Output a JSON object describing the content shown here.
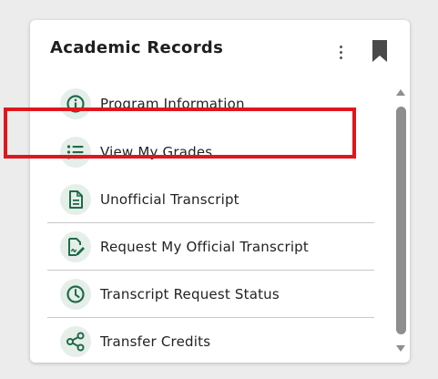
{
  "card": {
    "title": "Academic Records",
    "menu_icon": "more-vertical-icon",
    "bookmark_icon": "bookmark-icon"
  },
  "items": [
    {
      "label": "Program Information",
      "icon": "info-icon"
    },
    {
      "label": "View My Grades",
      "icon": "list-icon",
      "highlighted": true
    },
    {
      "label": "Unofficial Transcript",
      "icon": "document-icon"
    },
    {
      "label": "Request My Official Transcript",
      "icon": "signed-document-icon"
    },
    {
      "label": "Transcript Request Status",
      "icon": "clock-icon"
    },
    {
      "label": "Transfer Credits",
      "icon": "share-icon"
    }
  ],
  "colors": {
    "accent": "#1f6b4a",
    "icon_bg": "#e6eee9",
    "highlight": "#e0161d",
    "scroll_thumb": "#8e8e8e"
  }
}
